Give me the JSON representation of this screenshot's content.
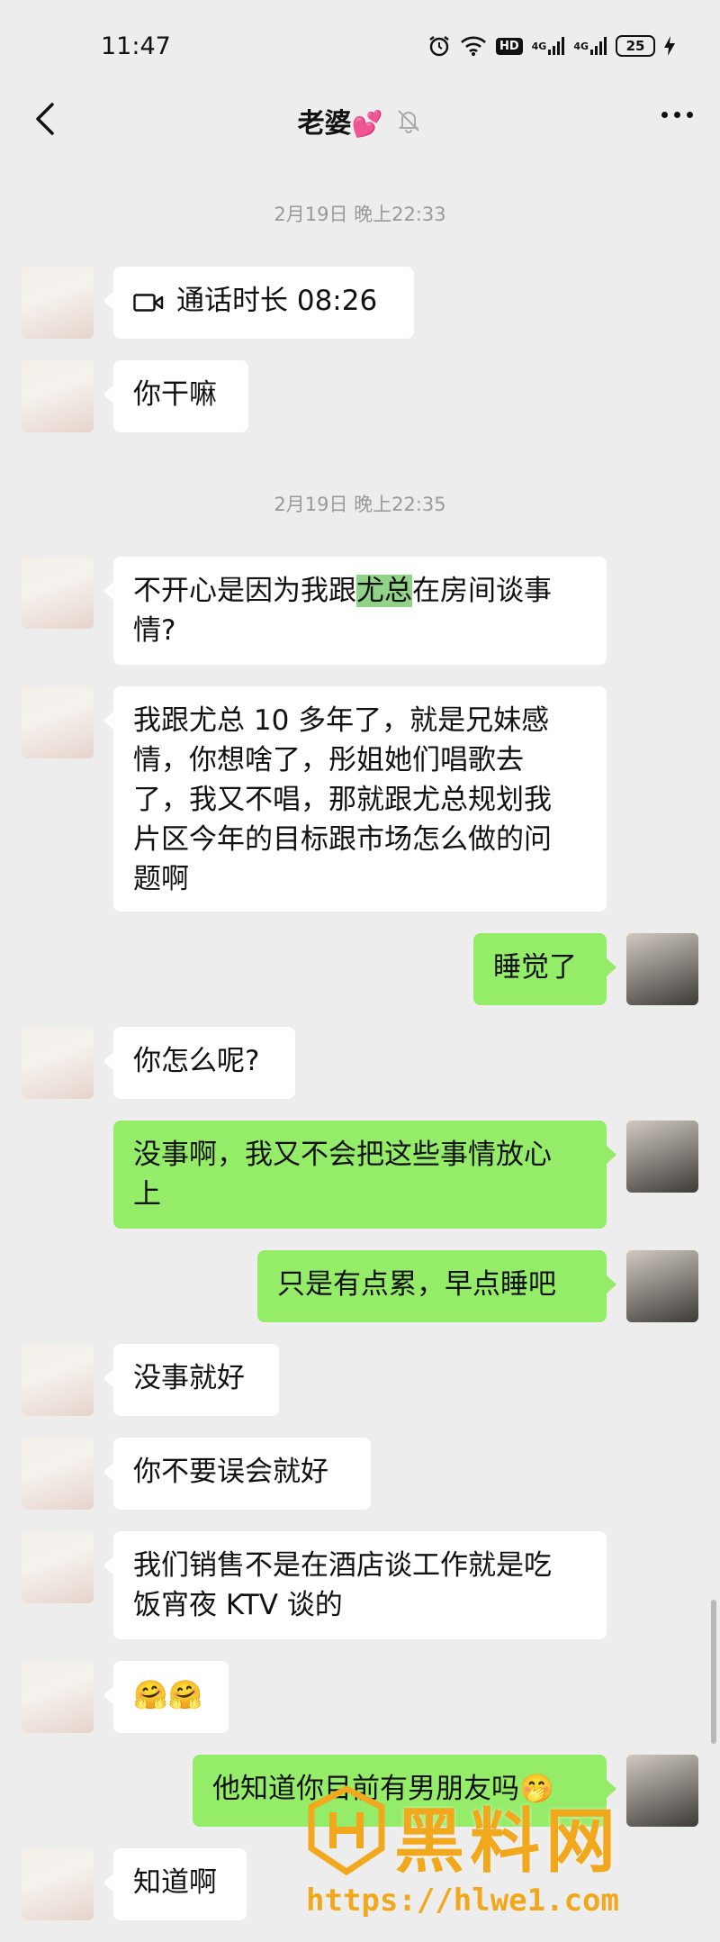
{
  "status_bar": {
    "time": "11:47",
    "hd_label": "HD",
    "signal1": "4G",
    "signal2": "4G",
    "battery": "25"
  },
  "nav": {
    "title": "老婆",
    "title_emoji": "💕"
  },
  "timestamps": [
    "2月19日 晚上22:33",
    "2月19日 晚上22:35"
  ],
  "messages": [
    {
      "from": "her",
      "text": "通话时长 08:26",
      "type": "call"
    },
    {
      "from": "her",
      "text": "你干嘛"
    },
    {
      "from": "her",
      "lines": [
        "不开心是因为我跟",
        "尤总",
        "在房间谈事",
        "情?"
      ]
    },
    {
      "from": "her",
      "lines": [
        "我跟尤总 10 多年了，就是兄妹感",
        "情，你想啥了，彤姐她们唱歌去",
        "了，我又不唱，那就跟尤总规划我",
        "片区今年的目标跟市场怎么做的问",
        "题啊"
      ]
    },
    {
      "from": "me",
      "text": "睡觉了"
    },
    {
      "from": "her",
      "text": "你怎么呢?"
    },
    {
      "from": "me",
      "lines": [
        "没事啊，我又不会把这些事情放心",
        "上"
      ]
    },
    {
      "from": "me",
      "text": "只是有点累，早点睡吧"
    },
    {
      "from": "her",
      "text": "没事就好"
    },
    {
      "from": "her",
      "text": "你不要误会就好"
    },
    {
      "from": "her",
      "lines": [
        "我们销售不是在酒店谈工作就是吃",
        "饭宵夜 KTV 谈的"
      ]
    },
    {
      "from": "her",
      "text": "🤗🤗"
    },
    {
      "from": "me",
      "text": "他知道你目前有男朋友吗🤭"
    },
    {
      "from": "her",
      "text": "知道啊"
    }
  ],
  "watermark": {
    "brand": "黑料网",
    "url": "https://hlwe1.com"
  },
  "colors": {
    "background": "#ededed",
    "my_bubble": "#95ec69",
    "her_bubble": "#ffffff",
    "highlight": "#92d38a"
  }
}
